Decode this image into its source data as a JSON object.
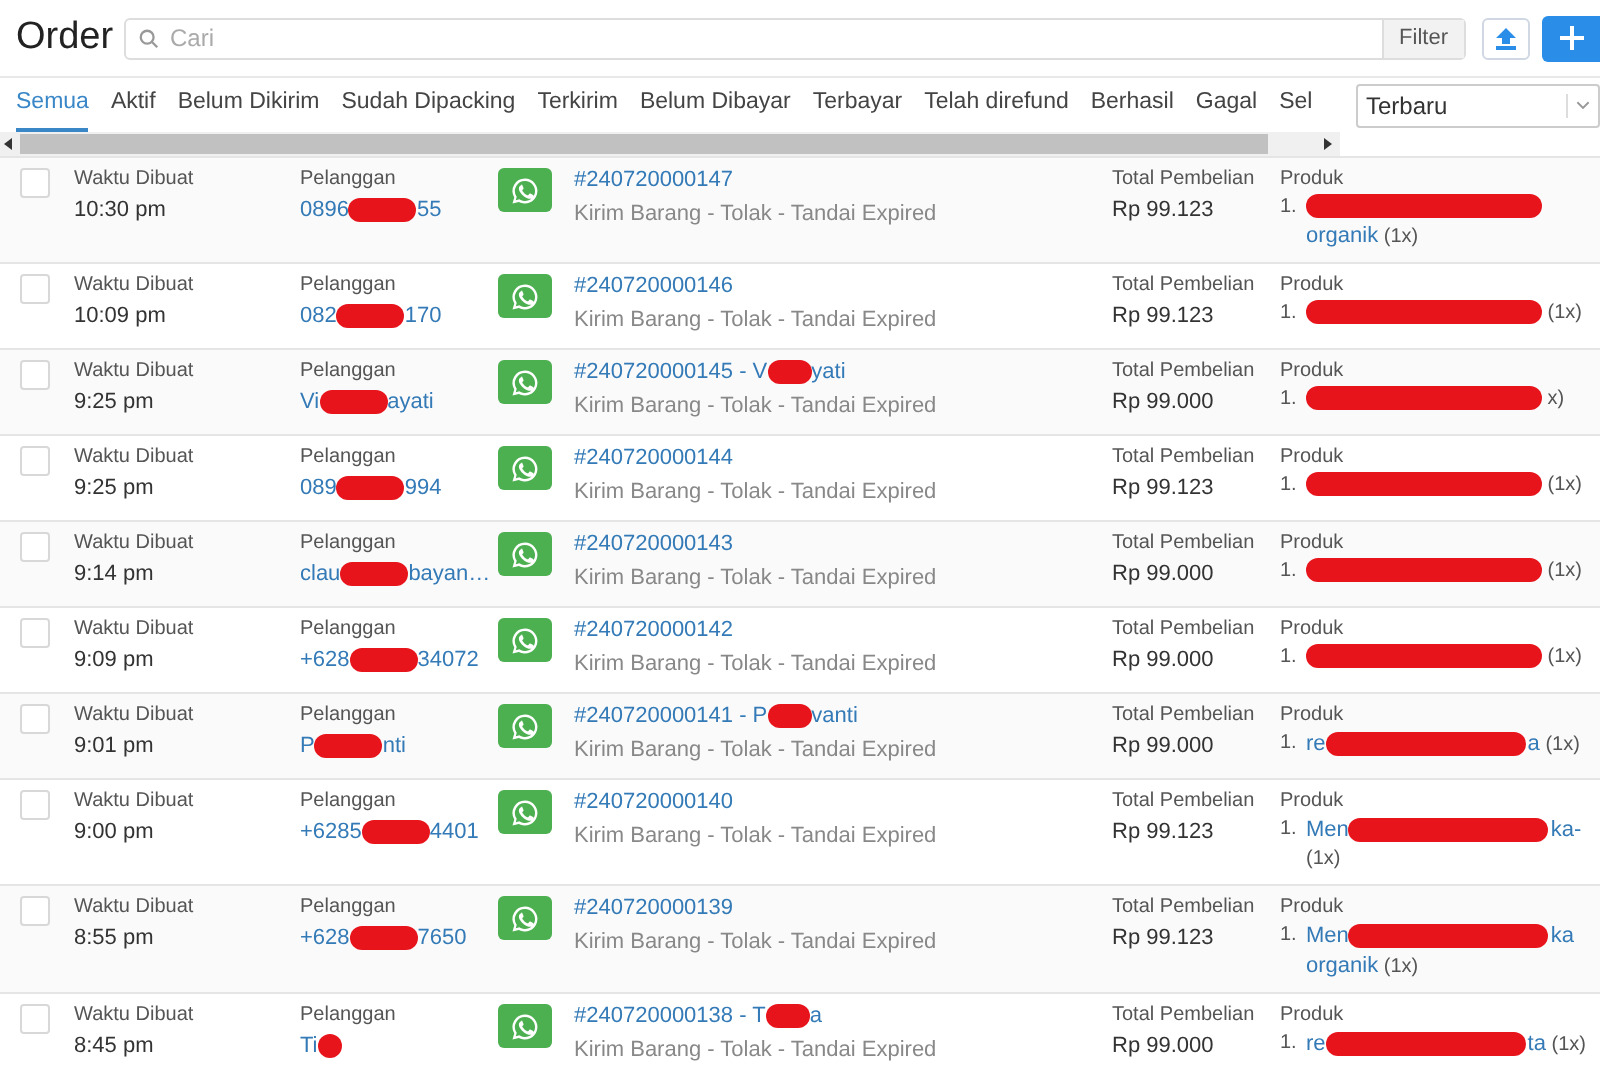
{
  "header": {
    "title": "Order",
    "search": {
      "placeholder": "Cari"
    },
    "filter_button": "Filter"
  },
  "tabs": [
    {
      "label": "Semua",
      "selected": true
    },
    {
      "label": "Aktif",
      "selected": false
    },
    {
      "label": "Belum Dikirim",
      "selected": false
    },
    {
      "label": "Sudah Dipacking",
      "selected": false
    },
    {
      "label": "Terkirim",
      "selected": false
    },
    {
      "label": "Belum Dibayar",
      "selected": false
    },
    {
      "label": "Terbayar",
      "selected": false
    },
    {
      "label": "Telah direfund",
      "selected": false
    },
    {
      "label": "Berhasil",
      "selected": false
    },
    {
      "label": "Gagal",
      "selected": false
    },
    {
      "label": "Sel",
      "selected": false
    }
  ],
  "sort": {
    "value": "Terbaru"
  },
  "orders": [
    {
      "checked": false,
      "time_label": "Waktu Dibuat",
      "time": "10:30 pm",
      "customer_label": "Pelanggan",
      "customer": [
        "0896",
        "55"
      ],
      "order": [
        "#240720000147"
      ],
      "status": "Kirim Barang - Tolak - Tandai Expired",
      "total_label": "Total Pembelian",
      "total": "Rp 99.123",
      "product_label": "Produk",
      "index": "1.",
      "product": {
        "next": "organik"
      },
      "qty": "(1x)"
    },
    {
      "checked": false,
      "time_label": "Waktu Dibuat",
      "time": "10:09 pm",
      "customer_label": "Pelanggan",
      "customer": [
        "082",
        "170"
      ],
      "order": [
        "#240720000146"
      ],
      "status": "Kirim Barang - Tolak - Tandai Expired",
      "total_label": "Total Pembelian",
      "total": "Rp 99.123",
      "product_label": "Produk",
      "index": "1.",
      "qty": "(1x)"
    },
    {
      "checked": false,
      "time_label": "Waktu Dibuat",
      "time": "9:25 pm",
      "customer_label": "Pelanggan",
      "customer": [
        "Vi",
        "ayati"
      ],
      "order": [
        "#240720000145 - V",
        "yati"
      ],
      "status": "Kirim Barang - Tolak - Tandai Expired",
      "total_label": "Total Pembelian",
      "total": "Rp 99.000",
      "product_label": "Produk",
      "index": "1.",
      "qty": "x)"
    },
    {
      "checked": false,
      "time_label": "Waktu Dibuat",
      "time": "9:25 pm",
      "customer_label": "Pelanggan",
      "customer": [
        "089",
        "994"
      ],
      "order": [
        "#240720000144"
      ],
      "status": "Kirim Barang - Tolak - Tandai Expired",
      "total_label": "Total Pembelian",
      "total": "Rp 99.123",
      "product_label": "Produk",
      "index": "1.",
      "qty": "(1x)"
    },
    {
      "checked": false,
      "time_label": "Waktu Dibuat",
      "time": "9:14 pm",
      "customer_label": "Pelanggan",
      "customer": [
        "clau",
        "bayan…"
      ],
      "order": [
        "#240720000143"
      ],
      "status": "Kirim Barang - Tolak - Tandai Expired",
      "total_label": "Total Pembelian",
      "total": "Rp 99.000",
      "product_label": "Produk",
      "index": "1.",
      "qty": "(1x)"
    },
    {
      "checked": false,
      "time_label": "Waktu Dibuat",
      "time": "9:09 pm",
      "customer_label": "Pelanggan",
      "customer": [
        "+628",
        "34072"
      ],
      "order": [
        "#240720000142"
      ],
      "status": "Kirim Barang - Tolak - Tandai Expired",
      "total_label": "Total Pembelian",
      "total": "Rp 99.000",
      "product_label": "Produk",
      "index": "1.",
      "qty": "(1x)"
    },
    {
      "checked": false,
      "time_label": "Waktu Dibuat",
      "time": "9:01 pm",
      "customer_label": "Pelanggan",
      "customer": [
        "P",
        "nti"
      ],
      "order": [
        "#240720000141 - P",
        "vanti"
      ],
      "status": "Kirim Barang - Tolak - Tandai Expired",
      "total_label": "Total Pembelian",
      "total": "Rp 99.000",
      "product_label": "Produk",
      "index": "1.",
      "product": {
        "lead": "re",
        "tail": "a"
      },
      "qty": "(1x)"
    },
    {
      "checked": false,
      "time_label": "Waktu Dibuat",
      "time": "9:00 pm",
      "customer_label": "Pelanggan",
      "customer": [
        "+6285",
        "4401"
      ],
      "order": [
        "#240720000140"
      ],
      "status": "Kirim Barang - Tolak - Tandai Expired",
      "total_label": "Total Pembelian",
      "total": "Rp 99.123",
      "product_label": "Produk",
      "index": "1.",
      "product": {
        "lead": "Men",
        "tail": "ka-"
      },
      "qty": "(1x)"
    },
    {
      "checked": false,
      "time_label": "Waktu Dibuat",
      "time": "8:55 pm",
      "customer_label": "Pelanggan",
      "customer": [
        "+628",
        "7650"
      ],
      "order": [
        "#240720000139"
      ],
      "status": "Kirim Barang - Tolak - Tandai Expired",
      "total_label": "Total Pembelian",
      "total": "Rp 99.123",
      "product_label": "Produk",
      "index": "1.",
      "product": {
        "lead": "Men",
        "tail": "ka",
        "next": "organik"
      },
      "qty": "(1x)"
    },
    {
      "checked": false,
      "time_label": "Waktu Dibuat",
      "time": "8:45 pm",
      "customer_label": "Pelanggan",
      "customer": [
        "Ti"
      ],
      "customer_redacted_end": true,
      "order": [
        "#240720000138 - T",
        "a"
      ],
      "status": "Kirim Barang - Tolak - Tandai Expired",
      "total_label": "Total Pembelian",
      "total": "Rp 99.000",
      "product_label": "Produk",
      "index": "1.",
      "product": {
        "lead": "re",
        "tail": "ta"
      },
      "qty": "(1x)"
    }
  ]
}
